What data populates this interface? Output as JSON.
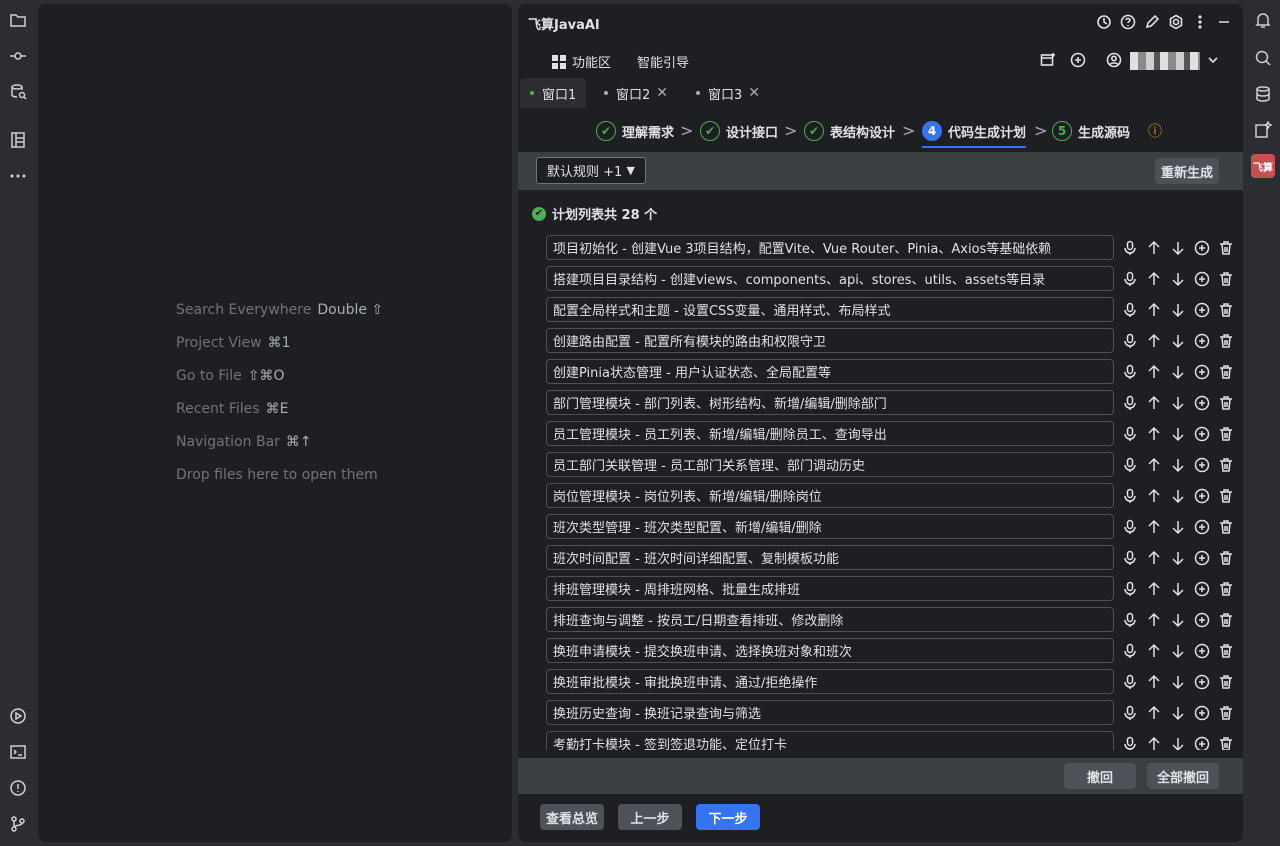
{
  "editor": {
    "hints": [
      {
        "label": "Search Everywhere",
        "key": "Double ⇧"
      },
      {
        "label": "Project View",
        "key": "⌘1"
      },
      {
        "label": "Go to File",
        "key": "⇧⌘O"
      },
      {
        "label": "Recent Files",
        "key": "⌘E"
      },
      {
        "label": "Navigation Bar",
        "key": "⌘↑"
      },
      {
        "label": "Drop files here to open them",
        "key": ""
      }
    ]
  },
  "tool": {
    "title": "飞算JavaAI",
    "nav": {
      "features": "功能区",
      "guide": "智能引导"
    },
    "window_tabs": [
      {
        "label": "窗口1",
        "active": true
      },
      {
        "label": "窗口2",
        "active": false
      },
      {
        "label": "窗口3",
        "active": false
      }
    ],
    "steps": [
      {
        "num": "✔",
        "label": "理解需求",
        "state": "done"
      },
      {
        "num": "✔",
        "label": "设计接口",
        "state": "done"
      },
      {
        "num": "✔",
        "label": "表结构设计",
        "state": "done"
      },
      {
        "num": "4",
        "label": "代码生成计划",
        "state": "active"
      },
      {
        "num": "5",
        "label": "生成源码",
        "state": "pending"
      }
    ],
    "info_icon": "ⓘ",
    "rule_select": "默认规则 +1",
    "regenerate": "重新生成",
    "plan_count": "计划列表共 28 个",
    "plan_items": [
      "项目初始化 - 创建Vue 3项目结构，配置Vite、Vue Router、Pinia、Axios等基础依赖",
      "搭建项目目录结构 - 创建views、components、api、stores、utils、assets等目录",
      "配置全局样式和主题 - 设置CSS变量、通用样式、布局样式",
      "创建路由配置 - 配置所有模块的路由和权限守卫",
      "创建Pinia状态管理 - 用户认证状态、全局配置等",
      "部门管理模块 - 部门列表、树形结构、新增/编辑/删除部门",
      "员工管理模块 - 员工列表、新增/编辑/删除员工、查询导出",
      "员工部门关联管理 - 员工部门关系管理、部门调动历史",
      "岗位管理模块 - 岗位列表、新增/编辑/删除岗位",
      "班次类型管理 - 班次类型配置、新增/编辑/删除",
      "班次时间配置 - 班次时间详细配置、复制模板功能",
      "排班管理模块 - 周排班网格、批量生成排班",
      "排班查询与调整 - 按员工/日期查看排班、修改删除",
      "换班申请模块 - 提交换班申请、选择换班对象和班次",
      "换班审批模块 - 审批换班申请、通过/拒绝操作",
      "换班历史查询 - 换班记录查询与筛选",
      "考勤打卡模块 - 签到签退功能、定位打卡"
    ],
    "undo": "撤回",
    "undo_all": "全部撤回",
    "overview": "查看总览",
    "prev": "上一步",
    "next": "下一步"
  },
  "right_rail": {
    "badge": "飞算"
  },
  "colors": {
    "accent": "#3574f0",
    "success": "#4caf50",
    "warning": "#e5a00d",
    "badge": "#c94f4f"
  }
}
